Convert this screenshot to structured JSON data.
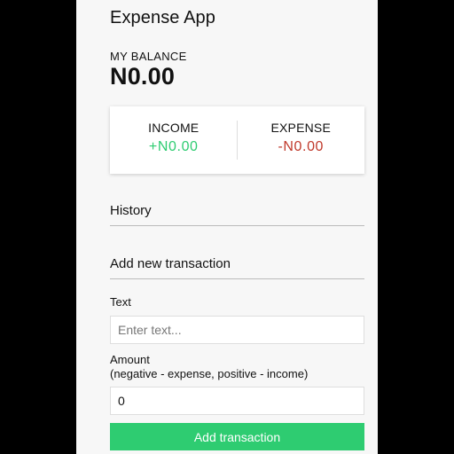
{
  "app": {
    "title": "Expense App"
  },
  "balance": {
    "label": "MY BALANCE",
    "amount": "N0.00"
  },
  "summary": {
    "income_label": "INCOME",
    "income_value": "+N0.00",
    "expense_label": "EXPENSE",
    "expense_value": "-N0.00"
  },
  "history": {
    "title": "History"
  },
  "form": {
    "title": "Add new transaction",
    "text_label": "Text",
    "text_placeholder": "Enter text...",
    "amount_label": "Amount",
    "amount_hint": "(negative - expense, positive - income)",
    "amount_value": "0",
    "submit_label": "Add transaction"
  },
  "colors": {
    "income": "#2ecc71",
    "expense": "#c0392b",
    "button": "#2ecc71"
  }
}
